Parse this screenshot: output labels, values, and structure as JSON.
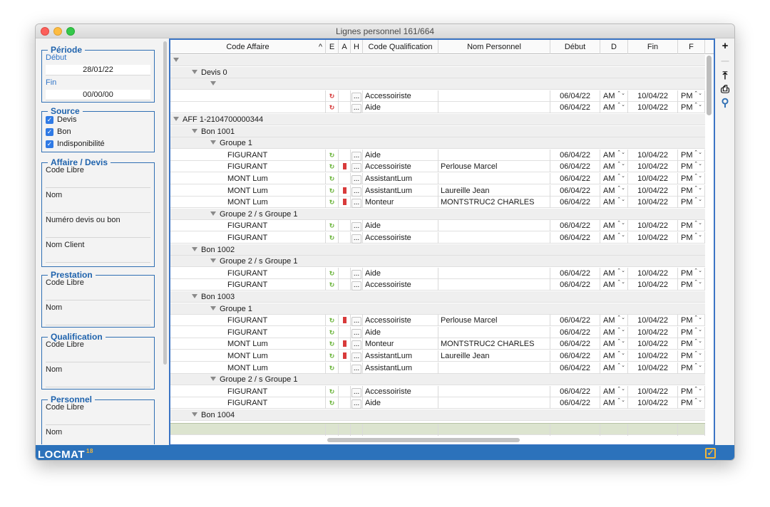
{
  "window": {
    "title": "Lignes personnel 161/664"
  },
  "periode": {
    "title": "Période",
    "debut_label": "Début",
    "debut_value": "28/01/22",
    "fin_label": "Fin",
    "fin_value": "00/00/00"
  },
  "source": {
    "title": "Source",
    "items": [
      {
        "label": "Devis",
        "checked": true
      },
      {
        "label": "Bon",
        "checked": true
      },
      {
        "label": "Indisponibilité",
        "checked": true
      }
    ]
  },
  "affaire": {
    "title": "Affaire / Devis",
    "fields": [
      "Code Libre",
      "Nom",
      "Numéro devis ou bon",
      "Nom Client"
    ]
  },
  "prestation": {
    "title": "Prestation",
    "fields": [
      "Code Libre",
      "Nom"
    ]
  },
  "qualification": {
    "title": "Qualification",
    "fields": [
      "Code Libre",
      "Nom"
    ]
  },
  "personnel": {
    "title": "Personnel",
    "fields": [
      "Code Libre",
      "Nom"
    ]
  },
  "columns": {
    "code_affaire": "Code Affaire",
    "sort_arrow": "^",
    "e": "E",
    "a": "A",
    "h": "H",
    "code_qualification": "Code Qualification",
    "nom_personnel": "Nom Personnel",
    "debut": "Début",
    "d": "D",
    "fin": "Fin",
    "f": "F"
  },
  "icons": {
    "e_symbol": "↻",
    "h_button": "...",
    "stepper": "⌃⌄"
  },
  "colors": {
    "accent": "#2f6fb3",
    "footer": "#2c72bb",
    "e_red": "#d63b3b",
    "e_green": "#6ab43a",
    "a_mark": "#d83a3a"
  },
  "rows": [
    {
      "type": "group",
      "level": 0,
      "label": ""
    },
    {
      "type": "group",
      "level": 1,
      "label": "Devis 0"
    },
    {
      "type": "group",
      "level": 2,
      "label": ""
    },
    {
      "type": "data",
      "code": "",
      "e": "red",
      "a": false,
      "qual": "Accessoiriste",
      "nom": "",
      "debut": "06/04/22",
      "d": "AM",
      "fin": "10/04/22",
      "f": "PM"
    },
    {
      "type": "data",
      "code": "",
      "e": "red",
      "a": false,
      "qual": "Aide",
      "nom": "",
      "debut": "06/04/22",
      "d": "AM",
      "fin": "10/04/22",
      "f": "PM"
    },
    {
      "type": "group",
      "level": 0,
      "label": "AFF 1-2104700000344"
    },
    {
      "type": "group",
      "level": 1,
      "label": "Bon 1001"
    },
    {
      "type": "group",
      "level": 2,
      "label": "Groupe 1"
    },
    {
      "type": "data",
      "code": "FIGURANT",
      "e": "green",
      "a": false,
      "qual": "Aide",
      "nom": "",
      "debut": "06/04/22",
      "d": "AM",
      "fin": "10/04/22",
      "f": "PM"
    },
    {
      "type": "data",
      "code": "FIGURANT",
      "e": "green",
      "a": true,
      "qual": "Accessoiriste",
      "nom": "Perlouse Marcel",
      "debut": "06/04/22",
      "d": "AM",
      "fin": "10/04/22",
      "f": "PM"
    },
    {
      "type": "data",
      "code": "MONT Lum",
      "e": "green",
      "a": false,
      "qual": "AssistantLum",
      "nom": "",
      "debut": "06/04/22",
      "d": "AM",
      "fin": "10/04/22",
      "f": "PM"
    },
    {
      "type": "data",
      "code": "MONT Lum",
      "e": "green",
      "a": true,
      "qual": "AssistantLum",
      "nom": "Laureille Jean",
      "debut": "06/04/22",
      "d": "AM",
      "fin": "10/04/22",
      "f": "PM"
    },
    {
      "type": "data",
      "code": "MONT Lum",
      "e": "green",
      "a": true,
      "qual": "Monteur",
      "nom": "MONTSTRUC2 CHARLES",
      "debut": "06/04/22",
      "d": "AM",
      "fin": "10/04/22",
      "f": "PM"
    },
    {
      "type": "group",
      "level": 2,
      "label": "Groupe 2 / s Groupe 1"
    },
    {
      "type": "data",
      "code": "FIGURANT",
      "e": "green",
      "a": false,
      "qual": "Aide",
      "nom": "",
      "debut": "06/04/22",
      "d": "AM",
      "fin": "10/04/22",
      "f": "PM"
    },
    {
      "type": "data",
      "code": "FIGURANT",
      "e": "green",
      "a": false,
      "qual": "Accessoiriste",
      "nom": "",
      "debut": "06/04/22",
      "d": "AM",
      "fin": "10/04/22",
      "f": "PM"
    },
    {
      "type": "group",
      "level": 1,
      "label": "Bon 1002"
    },
    {
      "type": "group",
      "level": 2,
      "label": "Groupe 2 / s Groupe 1"
    },
    {
      "type": "data",
      "code": "FIGURANT",
      "e": "green",
      "a": false,
      "qual": "Aide",
      "nom": "",
      "debut": "06/04/22",
      "d": "AM",
      "fin": "10/04/22",
      "f": "PM"
    },
    {
      "type": "data",
      "code": "FIGURANT",
      "e": "green",
      "a": false,
      "qual": "Accessoiriste",
      "nom": "",
      "debut": "06/04/22",
      "d": "AM",
      "fin": "10/04/22",
      "f": "PM"
    },
    {
      "type": "group",
      "level": 1,
      "label": "Bon 1003"
    },
    {
      "type": "group",
      "level": 2,
      "label": "Groupe 1"
    },
    {
      "type": "data",
      "code": "FIGURANT",
      "e": "green",
      "a": true,
      "qual": "Accessoiriste",
      "nom": "Perlouse Marcel",
      "debut": "06/04/22",
      "d": "AM",
      "fin": "10/04/22",
      "f": "PM"
    },
    {
      "type": "data",
      "code": "FIGURANT",
      "e": "green",
      "a": false,
      "qual": "Aide",
      "nom": "",
      "debut": "06/04/22",
      "d": "AM",
      "fin": "10/04/22",
      "f": "PM"
    },
    {
      "type": "data",
      "code": "MONT Lum",
      "e": "green",
      "a": true,
      "qual": "Monteur",
      "nom": "MONTSTRUC2 CHARLES",
      "debut": "06/04/22",
      "d": "AM",
      "fin": "10/04/22",
      "f": "PM"
    },
    {
      "type": "data",
      "code": "MONT Lum",
      "e": "green",
      "a": true,
      "qual": "AssistantLum",
      "nom": "Laureille Jean",
      "debut": "06/04/22",
      "d": "AM",
      "fin": "10/04/22",
      "f": "PM"
    },
    {
      "type": "data",
      "code": "MONT Lum",
      "e": "green",
      "a": false,
      "qual": "AssistantLum",
      "nom": "",
      "debut": "06/04/22",
      "d": "AM",
      "fin": "10/04/22",
      "f": "PM"
    },
    {
      "type": "group",
      "level": 2,
      "label": "Groupe 2 / s Groupe 1"
    },
    {
      "type": "data",
      "code": "FIGURANT",
      "e": "green",
      "a": false,
      "qual": "Accessoiriste",
      "nom": "",
      "debut": "06/04/22",
      "d": "AM",
      "fin": "10/04/22",
      "f": "PM"
    },
    {
      "type": "data",
      "code": "FIGURANT",
      "e": "green",
      "a": false,
      "qual": "Aide",
      "nom": "",
      "debut": "06/04/22",
      "d": "AM",
      "fin": "10/04/22",
      "f": "PM"
    },
    {
      "type": "group",
      "level": 1,
      "label": "Bon 1004"
    }
  ],
  "toolbar": {
    "add": "+",
    "remove": "—",
    "export": "⤒",
    "print": "⎙",
    "search": "⚲"
  },
  "footer": {
    "logo": "LOCMAT",
    "version": "18",
    "validate": "✓"
  }
}
